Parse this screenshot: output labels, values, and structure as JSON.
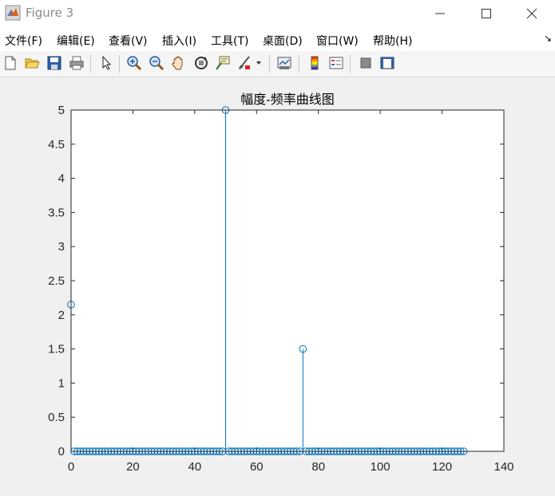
{
  "window": {
    "title": "Figure 3"
  },
  "menu": [
    "文件(F)",
    "编辑(E)",
    "查看(V)",
    "插入(I)",
    "工具(T)",
    "桌面(D)",
    "窗口(W)",
    "帮助(H)"
  ],
  "toolbar": {
    "icons": [
      "new-figure-icon",
      "open-file-icon",
      "save-icon",
      "print-icon",
      "edit-plot-arrow-icon",
      "zoom-in-icon",
      "zoom-out-icon",
      "pan-hand-icon",
      "rotate-3d-icon",
      "data-cursor-icon",
      "brush-icon",
      "brush-dropdown-icon",
      "link-plot-icon",
      "colorbar-icon",
      "legend-icon",
      "hide-plot-tools-icon",
      "show-plot-tools-icon"
    ]
  },
  "colors": {
    "stem": "#0072bd",
    "axes_bg": "#ffffff",
    "figure_bg": "#f0f0f0"
  },
  "chart_data": {
    "type": "stem",
    "title": "幅度-频率曲线图",
    "xlabel": "",
    "ylabel": "",
    "xlim": [
      0,
      140
    ],
    "ylim": [
      0,
      5
    ],
    "xticks": [
      "0",
      "20",
      "40",
      "60",
      "80",
      "100",
      "120",
      "140"
    ],
    "yticks": [
      "0",
      "0.5",
      "1",
      "1.5",
      "2",
      "2.5",
      "3",
      "3.5",
      "4",
      "4.5",
      "5"
    ],
    "n_points": 128,
    "x": "0..127 (integer sample index)",
    "values": {
      "default": 0,
      "nonzero": [
        {
          "x": 0,
          "y": 2.15
        },
        {
          "x": 50,
          "y": 5.0
        },
        {
          "x": 75,
          "y": 1.5
        }
      ]
    }
  }
}
